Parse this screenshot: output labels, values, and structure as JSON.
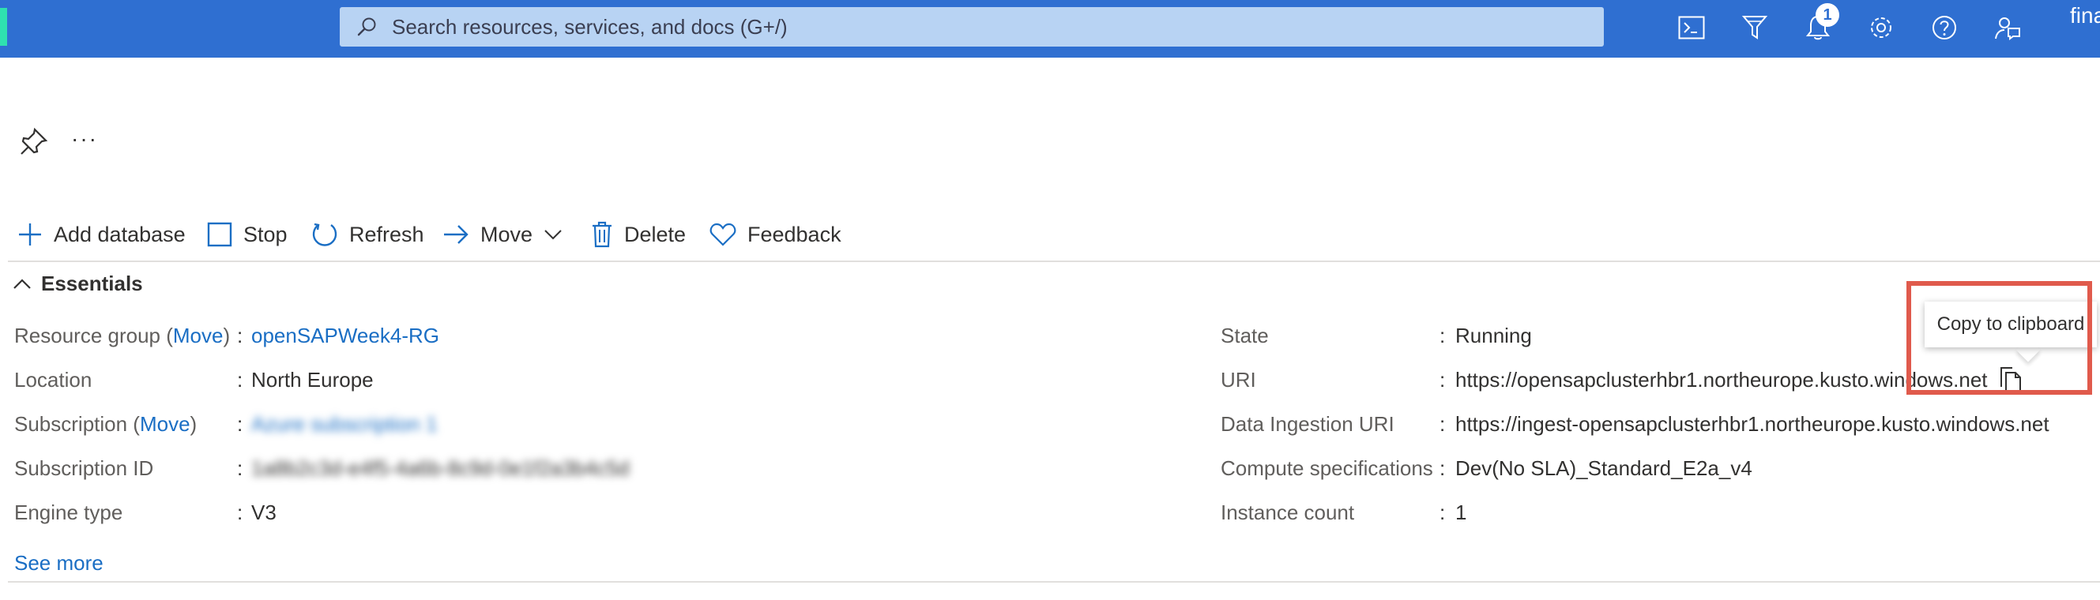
{
  "topbar": {
    "search_placeholder": "Search resources, services, and docs (G+/)",
    "notification_count": "1",
    "user": "fina",
    "icons": [
      "cloud-shell-icon",
      "directory-filter-icon",
      "notifications-icon",
      "settings-icon",
      "help-icon",
      "feedback-icon"
    ]
  },
  "header": {
    "more_label": "···"
  },
  "commands": {
    "add_database": "Add database",
    "stop": "Stop",
    "refresh": "Refresh",
    "move": "Move",
    "delete": "Delete",
    "feedback": "Feedback"
  },
  "essentials": {
    "title": "Essentials",
    "left": {
      "resource_group_label": "Resource group",
      "resource_group_move": "Move",
      "resource_group_value": "openSAPWeek4-RG",
      "location_label": "Location",
      "location_value": "North Europe",
      "subscription_label": "Subscription",
      "subscription_move": "Move",
      "subscription_value": "Azure subscription 1",
      "subscription_id_label": "Subscription ID",
      "subscription_id_value": "1a8b2c3d-e4f5-4a6b-8c9d-0e1f2a3b4c5d",
      "engine_type_label": "Engine type",
      "engine_type_value": "V3"
    },
    "right": {
      "state_label": "State",
      "state_value": "Running",
      "uri_label": "URI",
      "uri_value": "https://opensapclusterhbr1.northeurope.kusto.windows.net",
      "ingestion_label": "Data Ingestion URI",
      "ingestion_value": "https://ingest-opensapclusterhbr1.northeurope.kusto.windows.net",
      "compute_label": "Compute specifications",
      "compute_value": "Dev(No SLA)_Standard_E2a_v4",
      "instance_label": "Instance count",
      "instance_value": "1"
    },
    "separator": ":",
    "see_more": "See more"
  },
  "tooltip": {
    "text": "Copy to clipboard"
  },
  "colors": {
    "topbar": "#2f6fd1",
    "link": "#1a6ec4",
    "highlight": "#e05a4c"
  }
}
